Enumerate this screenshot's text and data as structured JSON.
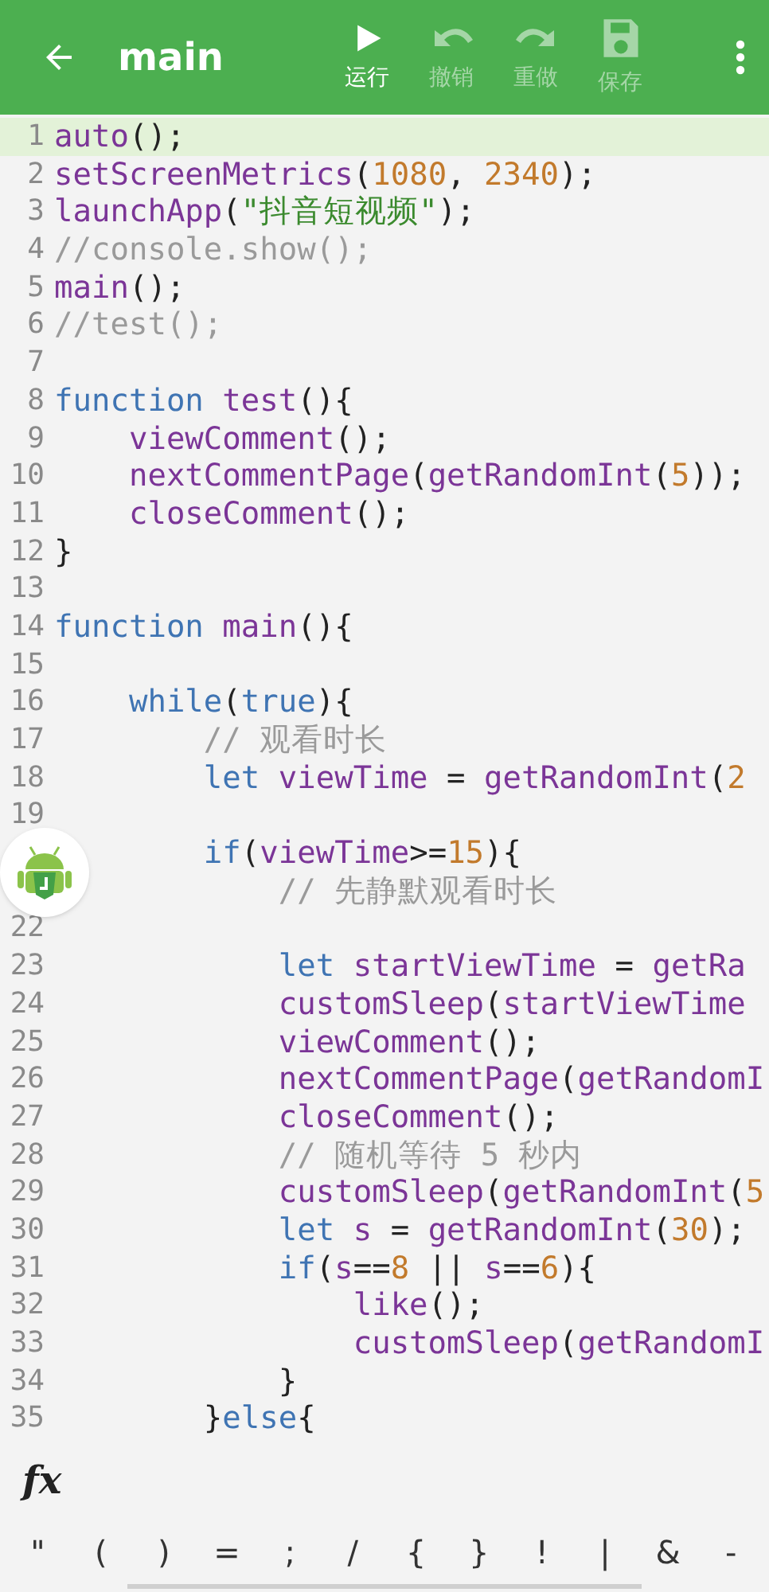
{
  "toolbar": {
    "title": "main",
    "actions": [
      {
        "kind": "run",
        "label": "运行",
        "disabled": false
      },
      {
        "kind": "undo",
        "label": "撤销",
        "disabled": true
      },
      {
        "kind": "redo",
        "label": "重做",
        "disabled": true
      },
      {
        "kind": "save",
        "label": "保存",
        "disabled": true
      }
    ]
  },
  "editor": {
    "lines": [
      {
        "number": "1",
        "current": true,
        "tokens": [
          {
            "kind": "fn",
            "text": "auto"
          },
          {
            "kind": "p",
            "text": "();"
          }
        ]
      },
      {
        "number": "2",
        "current": false,
        "tokens": [
          {
            "kind": "fn",
            "text": "setScreenMetrics"
          },
          {
            "kind": "p",
            "text": "("
          },
          {
            "kind": "num",
            "text": "1080"
          },
          {
            "kind": "p",
            "text": ","
          },
          {
            "kind": "num",
            "text": " 2340"
          },
          {
            "kind": "p",
            "text": ");"
          }
        ]
      },
      {
        "number": "3",
        "current": false,
        "tokens": [
          {
            "kind": "fn",
            "text": "launchApp"
          },
          {
            "kind": "p",
            "text": "("
          },
          {
            "kind": "str",
            "text": "\"抖音短视频\""
          },
          {
            "kind": "p",
            "text": ");"
          }
        ]
      },
      {
        "number": "4",
        "current": false,
        "tokens": [
          {
            "kind": "com",
            "text": "//console.show();"
          }
        ]
      },
      {
        "number": "5",
        "current": false,
        "tokens": [
          {
            "kind": "fn",
            "text": "main"
          },
          {
            "kind": "p",
            "text": "();"
          }
        ]
      },
      {
        "number": "6",
        "current": false,
        "tokens": [
          {
            "kind": "com",
            "text": "//test();"
          }
        ]
      },
      {
        "number": "7",
        "current": false
      },
      {
        "number": "8",
        "current": false,
        "tokens": [
          {
            "kind": "kw",
            "text": "function"
          },
          {
            "kind": "fn",
            "text": " test"
          },
          {
            "kind": "p",
            "text": "(){"
          }
        ]
      },
      {
        "number": "9",
        "current": false,
        "tokens": [
          {
            "kind": "fn",
            "text": "    viewComment"
          },
          {
            "kind": "p",
            "text": "();"
          }
        ]
      },
      {
        "number": "10",
        "current": false,
        "tokens": [
          {
            "kind": "fn",
            "text": "    nextCommentPage"
          },
          {
            "kind": "p",
            "text": "("
          },
          {
            "kind": "fn",
            "text": "getRandomInt"
          },
          {
            "kind": "p",
            "text": "("
          },
          {
            "kind": "num",
            "text": "5"
          },
          {
            "kind": "p",
            "text": "));"
          }
        ]
      },
      {
        "number": "11",
        "current": false,
        "tokens": [
          {
            "kind": "fn",
            "text": "    closeComment"
          },
          {
            "kind": "p",
            "text": "();"
          }
        ]
      },
      {
        "number": "12",
        "current": false,
        "tokens": [
          {
            "kind": "p",
            "text": "}"
          }
        ]
      },
      {
        "number": "13",
        "current": false
      },
      {
        "number": "14",
        "current": false,
        "tokens": [
          {
            "kind": "kw",
            "text": "function"
          },
          {
            "kind": "fn",
            "text": " main"
          },
          {
            "kind": "p",
            "text": "(){"
          }
        ]
      },
      {
        "number": "15",
        "current": false
      },
      {
        "number": "16",
        "current": false,
        "tokens": [
          {
            "kind": "kw",
            "text": "    while"
          },
          {
            "kind": "p",
            "text": "("
          },
          {
            "kind": "kw",
            "text": "true"
          },
          {
            "kind": "p",
            "text": "){"
          }
        ]
      },
      {
        "number": "17",
        "current": false,
        "tokens": [
          {
            "kind": "com",
            "text": "        // 观看时长"
          }
        ]
      },
      {
        "number": "18",
        "current": false,
        "tokens": [
          {
            "kind": "kw",
            "text": "        let"
          },
          {
            "kind": "fn",
            "text": " viewTime"
          },
          {
            "kind": "p",
            "text": " ="
          },
          {
            "kind": "fn",
            "text": " getRandomInt"
          },
          {
            "kind": "p",
            "text": "("
          },
          {
            "kind": "num",
            "text": "2"
          }
        ]
      },
      {
        "number": "19",
        "current": false
      },
      {
        "current": false,
        "tokens": [
          {
            "kind": "kw",
            "text": "        if"
          },
          {
            "kind": "p",
            "text": "("
          },
          {
            "kind": "fn",
            "text": "viewTime"
          },
          {
            "kind": "p",
            "text": ">="
          },
          {
            "kind": "num",
            "text": "15"
          },
          {
            "kind": "p",
            "text": "){"
          }
        ]
      },
      {
        "current": false,
        "tokens": [
          {
            "kind": "com",
            "text": "            // 先静默观看时长"
          }
        ]
      },
      {
        "number": "22",
        "current": false
      },
      {
        "number": "23",
        "current": false,
        "tokens": [
          {
            "kind": "kw",
            "text": "            let"
          },
          {
            "kind": "fn",
            "text": " startViewTime"
          },
          {
            "kind": "p",
            "text": " ="
          },
          {
            "kind": "fn",
            "text": " getRa"
          }
        ]
      },
      {
        "number": "24",
        "current": false,
        "tokens": [
          {
            "kind": "fn",
            "text": "            customSleep"
          },
          {
            "kind": "p",
            "text": "("
          },
          {
            "kind": "fn",
            "text": "startViewTime"
          }
        ]
      },
      {
        "number": "25",
        "current": false,
        "tokens": [
          {
            "kind": "fn",
            "text": "            viewComment"
          },
          {
            "kind": "p",
            "text": "();"
          }
        ]
      },
      {
        "number": "26",
        "current": false,
        "tokens": [
          {
            "kind": "fn",
            "text": "            nextCommentPage"
          },
          {
            "kind": "p",
            "text": "("
          },
          {
            "kind": "fn",
            "text": "getRandomI"
          }
        ]
      },
      {
        "number": "27",
        "current": false,
        "tokens": [
          {
            "kind": "fn",
            "text": "            closeComment"
          },
          {
            "kind": "p",
            "text": "();"
          }
        ]
      },
      {
        "number": "28",
        "current": false,
        "tokens": [
          {
            "kind": "com",
            "text": "            // 随机等待 5 秒内"
          }
        ]
      },
      {
        "number": "29",
        "current": false,
        "tokens": [
          {
            "kind": "fn",
            "text": "            customSleep"
          },
          {
            "kind": "p",
            "text": "("
          },
          {
            "kind": "fn",
            "text": "getRandomInt"
          },
          {
            "kind": "p",
            "text": "("
          },
          {
            "kind": "num",
            "text": "5"
          }
        ]
      },
      {
        "number": "30",
        "current": false,
        "tokens": [
          {
            "kind": "kw",
            "text": "            let"
          },
          {
            "kind": "fn",
            "text": " s"
          },
          {
            "kind": "p",
            "text": " ="
          },
          {
            "kind": "fn",
            "text": " getRandomInt"
          },
          {
            "kind": "p",
            "text": "("
          },
          {
            "kind": "num",
            "text": "30"
          },
          {
            "kind": "p",
            "text": ");"
          }
        ]
      },
      {
        "number": "31",
        "current": false,
        "tokens": [
          {
            "kind": "kw",
            "text": "            if"
          },
          {
            "kind": "p",
            "text": "("
          },
          {
            "kind": "fn",
            "text": "s"
          },
          {
            "kind": "p",
            "text": "=="
          },
          {
            "kind": "num",
            "text": "8"
          },
          {
            "kind": "p",
            "text": " ||"
          },
          {
            "kind": "fn",
            "text": " s"
          },
          {
            "kind": "p",
            "text": "=="
          },
          {
            "kind": "num",
            "text": "6"
          },
          {
            "kind": "p",
            "text": "){"
          }
        ]
      },
      {
        "number": "32",
        "current": false,
        "tokens": [
          {
            "kind": "fn",
            "text": "                like"
          },
          {
            "kind": "p",
            "text": "();"
          }
        ]
      },
      {
        "number": "33",
        "current": false,
        "tokens": [
          {
            "kind": "fn",
            "text": "                customSleep"
          },
          {
            "kind": "p",
            "text": "("
          },
          {
            "kind": "fn",
            "text": "getRandomI"
          }
        ]
      },
      {
        "number": "34",
        "current": false,
        "tokens": [
          {
            "kind": "p",
            "text": "            }"
          }
        ]
      },
      {
        "number": "35",
        "current": false,
        "tokens": [
          {
            "kind": "p",
            "text": "        }"
          },
          {
            "kind": "kw",
            "text": "else"
          },
          {
            "kind": "p",
            "text": "{"
          }
        ]
      }
    ]
  },
  "function_bar": {
    "label": "fx"
  },
  "symbol_keys": [
    "\"",
    "(",
    ")",
    "=",
    ";",
    "/",
    "{",
    "}",
    "!",
    "|",
    "&",
    "-"
  ]
}
